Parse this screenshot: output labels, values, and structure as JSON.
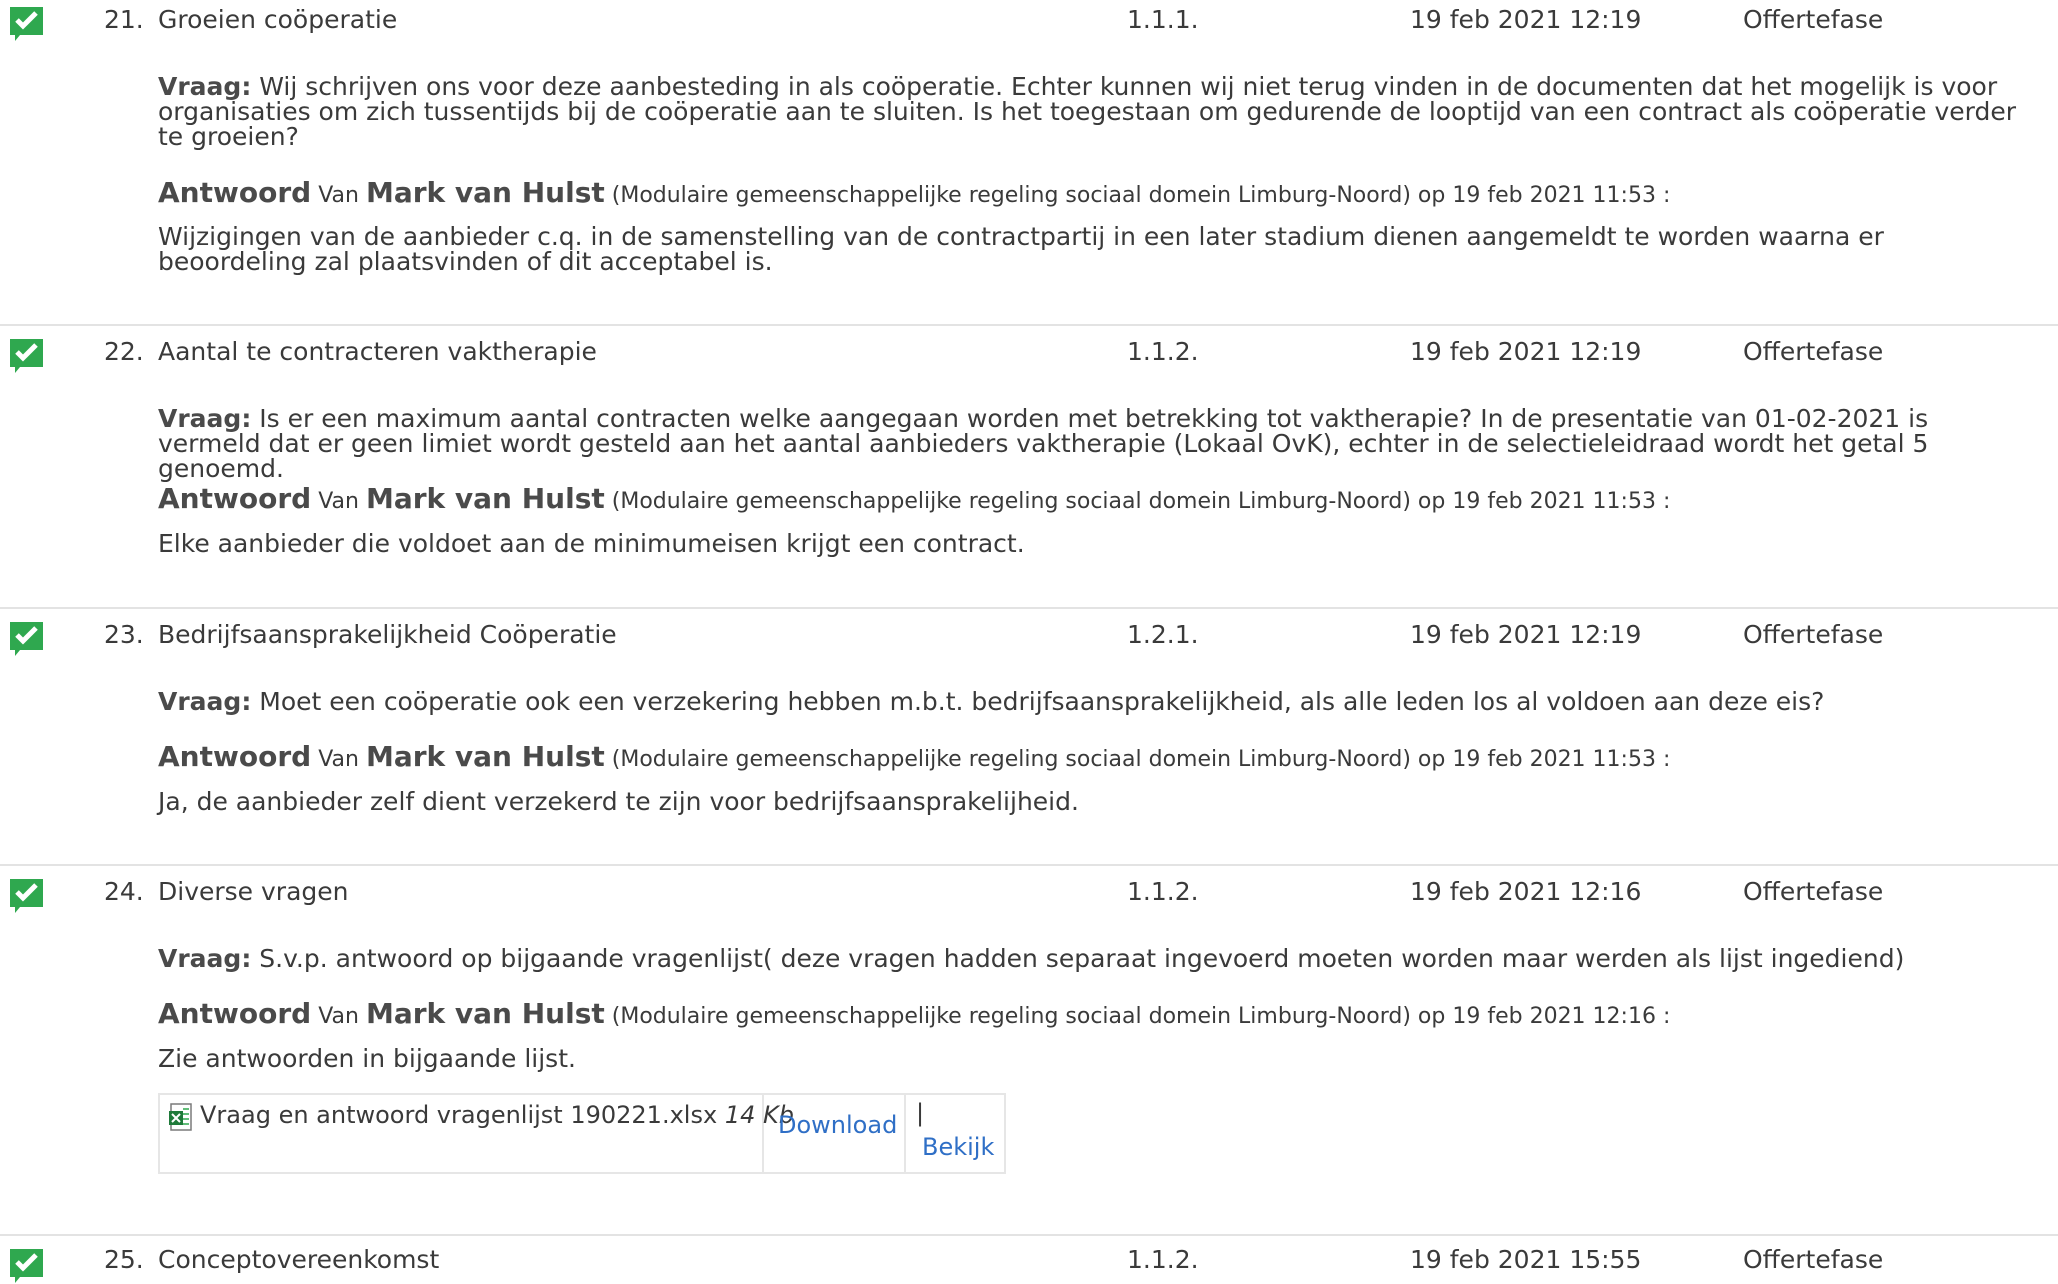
{
  "items": [
    {
      "number": "21.",
      "title": "Groeien coöperatie",
      "ref": "1.1.1.",
      "date": "19 feb 2021 12:19",
      "phase": "Offertefase",
      "question_label": "Vraag:",
      "question": "Wij schrijven ons voor deze aanbesteding in als coöperatie. Echter kunnen wij niet terug vinden in de documenten dat het mogelijk is voor organisaties om zich tussentijds bij de coöperatie aan te sluiten. Is het toegestaan om gedurende de looptijd van een contract als coöperatie verder te groeien?",
      "answer_label": "Antwoord",
      "van": "Van",
      "author": "Mark van Hulst",
      "org": "(Modulaire gemeenschappelijke regeling sociaal domein Limburg-Noord)",
      "op": "op",
      "answer_date": "19 feb 2021 11:53",
      "colon": ":",
      "answer": "Wijzigingen van de aanbieder c.q. in de samenstelling van de contractpartij in een later stadium dienen aangemeldt te worden waarna er beoordeling zal plaatsvinden of dit acceptabel is."
    },
    {
      "number": "22.",
      "title": "Aantal te contracteren vaktherapie",
      "ref": "1.1.2.",
      "date": "19 feb 2021 12:19",
      "phase": "Offertefase",
      "question_label": "Vraag:",
      "question": "Is er een maximum aantal contracten welke aangegaan worden met betrekking tot vaktherapie? In de presentatie van 01-02-2021 is vermeld dat er geen limiet wordt gesteld aan het aantal aanbieders vaktherapie (Lokaal OvK), echter in de selectieleidraad wordt het getal 5 genoemd.",
      "answer_label": "Antwoord",
      "van": "Van",
      "author": "Mark van Hulst",
      "org": "(Modulaire gemeenschappelijke regeling sociaal domein Limburg-Noord)",
      "op": "op",
      "answer_date": "19 feb 2021 11:53",
      "colon": ":",
      "answer": "Elke aanbieder die voldoet aan de minimumeisen krijgt een contract."
    },
    {
      "number": "23.",
      "title": "Bedrijfsaansprakelijkheid Coöperatie",
      "ref": "1.2.1.",
      "date": "19 feb 2021 12:19",
      "phase": "Offertefase",
      "question_label": "Vraag:",
      "question": "Moet een coöperatie ook een verzekering hebben m.b.t. bedrijfsaansprakelijkheid, als alle leden los al voldoen aan deze eis?",
      "answer_label": "Antwoord",
      "van": "Van",
      "author": "Mark van Hulst",
      "org": "(Modulaire gemeenschappelijke regeling sociaal domein Limburg-Noord)",
      "op": "op",
      "answer_date": "19 feb 2021 11:53",
      "colon": ":",
      "answer": "Ja, de aanbieder zelf dient verzekerd te zijn voor bedrijfsaansprakelijheid."
    },
    {
      "number": "24.",
      "title": "Diverse vragen",
      "ref": "1.1.2.",
      "date": "19 feb 2021 12:16",
      "phase": "Offertefase",
      "question_label": "Vraag:",
      "question": "S.v.p. antwoord op bijgaande vragenlijst( deze vragen hadden separaat ingevoerd moeten worden maar werden als lijst ingediend)",
      "answer_label": "Antwoord",
      "van": "Van",
      "author": "Mark van Hulst",
      "org": "(Modulaire gemeenschappelijke regeling sociaal domein Limburg-Noord)",
      "op": "op",
      "answer_date": "19 feb 2021 12:16",
      "colon": ":",
      "answer": "Zie antwoorden in bijgaande lijst.",
      "attachment": {
        "filename": "Vraag en antwoord vragenlijst 190221.xlsx",
        "size": "14 Kb",
        "download": "Download",
        "separator": "|",
        "view": "Bekijk"
      }
    },
    {
      "number": "25.",
      "title": "Conceptovereenkomst",
      "ref": "1.1.2.",
      "date": "19 feb 2021 15:55",
      "phase": "Offertefase"
    }
  ],
  "colors": {
    "check_green": "#2fa84f",
    "link": "#2f6fc6",
    "separator": "#e3e3e3"
  }
}
